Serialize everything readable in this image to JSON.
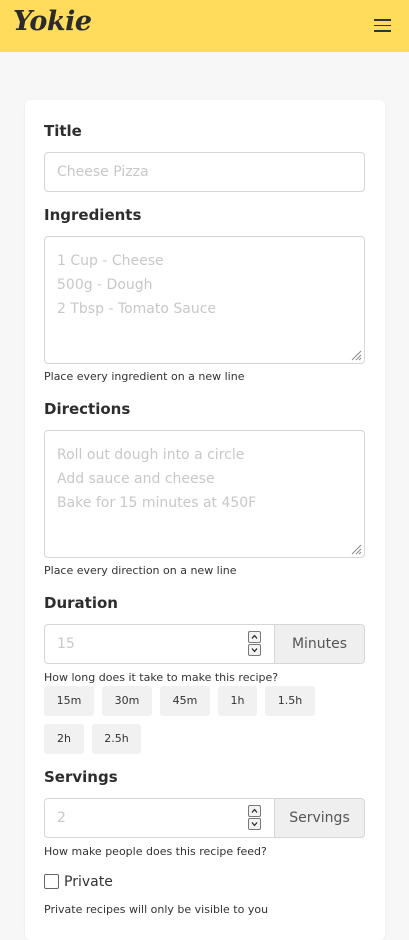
{
  "app": {
    "brand": "Yokie",
    "accent_color": "#ffdc5c",
    "menu_icon": "hamburger-menu-icon"
  },
  "form": {
    "title": {
      "label": "Title",
      "placeholder": "Cheese Pizza"
    },
    "ingredients": {
      "label": "Ingredients",
      "placeholder_lines": [
        "1 Cup - Cheese",
        "500g - Dough",
        "2 Tbsp - Tomato Sauce"
      ],
      "help": "Place every ingredient on a new line"
    },
    "directions": {
      "label": "Directions",
      "placeholder_lines": [
        "Roll out dough into a circle",
        "Add sauce and cheese",
        "Bake for 15 minutes at 450F"
      ],
      "help": "Place every direction on a new line"
    },
    "duration": {
      "label": "Duration",
      "placeholder": "15",
      "unit": "Minutes",
      "help": "How long does it take to make this recipe?",
      "presets": [
        "15m",
        "30m",
        "45m",
        "1h",
        "1.5h",
        "2h",
        "2.5h"
      ]
    },
    "servings": {
      "label": "Servings",
      "placeholder": "2",
      "unit": "Servings",
      "help": "How make people does this recipe feed?"
    },
    "private": {
      "label": "Private",
      "checked": false,
      "help": "Private recipes will only be visible to you"
    }
  }
}
